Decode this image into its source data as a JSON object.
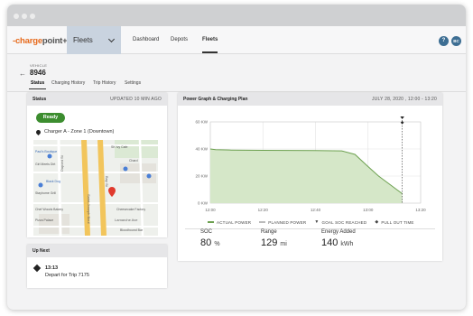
{
  "app": {
    "logo_left": "-charge",
    "logo_right": "point+",
    "fleet_selector": "Fleets",
    "nav": [
      "Dashboard",
      "Depots",
      "Fleets"
    ],
    "active_nav": "Fleets",
    "help_label": "?",
    "avatar_initials": "BC"
  },
  "vehicle": {
    "label": "VEHICLE",
    "id": "8946",
    "tabs": [
      "Status",
      "Charging History",
      "Trip History",
      "Settings"
    ],
    "active_tab": "Status"
  },
  "status_card": {
    "title": "Status",
    "updated": "UPDATED 10 MIN AGO",
    "state": "Ready",
    "charger": "Charger A - Zone 1 (Downtown)"
  },
  "map": {
    "streets": [
      "Saint-Joseph Boul",
      "Dupont St",
      "Lamarche Ave",
      "Bay St"
    ],
    "places": [
      "Paul's Boutique",
      "SK Ivy Cafe",
      "Girl Meets Dirt",
      "Chard",
      "Black Dog",
      "Stayhome Grill",
      "Cheesecake Factory",
      "Chef Woods Bakery",
      "Bloodhound Bar",
      "Pizza Palace"
    ]
  },
  "upnext_card": {
    "title": "Up Next",
    "time": "13:13",
    "description": "Depart for Trip 7175"
  },
  "power_card": {
    "title": "Power Graph & Charging Plan",
    "date_range": "JULY 28, 2020 , 12:00 - 13:20"
  },
  "chart_data": {
    "type": "area",
    "x": [
      "12:00",
      "12:02",
      "12:08",
      "12:20",
      "12:40",
      "12:50",
      "12:55",
      "13:00",
      "13:04",
      "13:13"
    ],
    "series": [
      {
        "name": "ACTUAL POWER",
        "values": [
          40,
          39.5,
          39.2,
          39,
          38.8,
          38.6,
          36,
          27,
          20,
          7
        ]
      }
    ],
    "x_ticks": [
      "12:00",
      "12:20",
      "12:40",
      "13:00",
      "13:20"
    ],
    "y_ticks": [
      "0 KW",
      "20 KW",
      "40 KW",
      "60 KW"
    ],
    "ylim": [
      0,
      60
    ],
    "legend": [
      "ACTUAL POWER",
      "PLANNED POWER",
      "GOAL SOC REACHED",
      "PULL OUT TIME"
    ],
    "legend_position": "bottom",
    "pull_out_time": "13:13",
    "grid": true,
    "colors": {
      "area": "#d5e7c8",
      "line": "#6ca04f",
      "planned": "#bbbbbb"
    }
  },
  "stats": [
    {
      "label": "SOC",
      "value": "80",
      "unit": "%"
    },
    {
      "label": "Range",
      "value": "129",
      "unit": "mi"
    },
    {
      "label": "Energy Added",
      "value": "140",
      "unit": "kWh"
    }
  ]
}
